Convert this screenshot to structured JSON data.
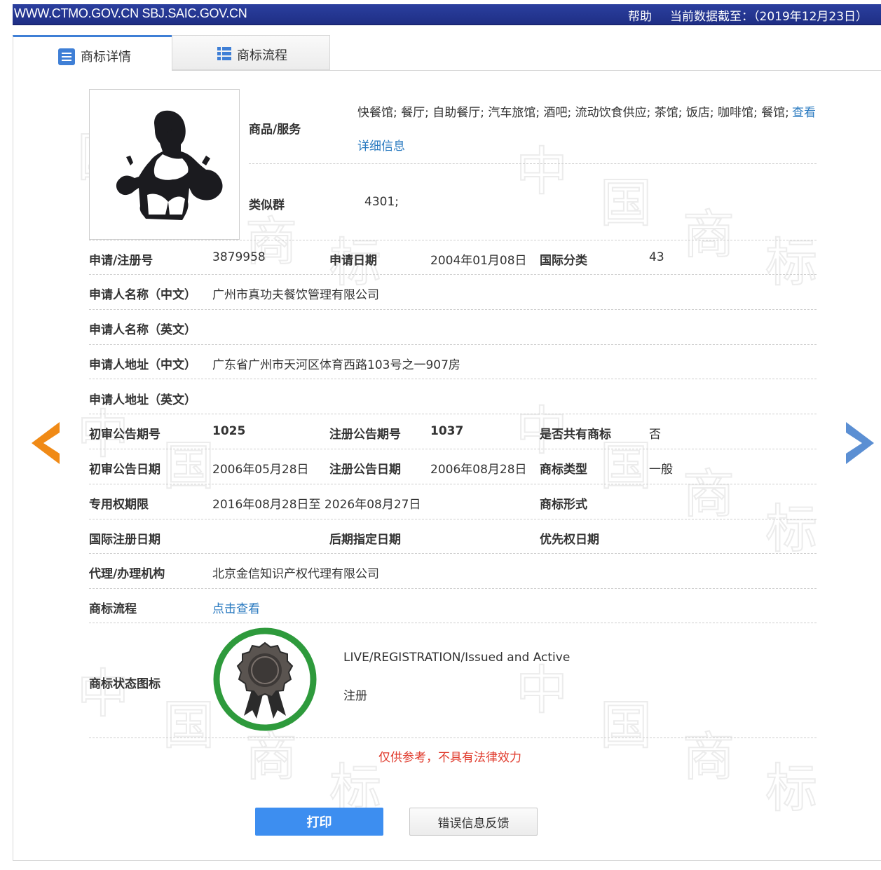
{
  "topbar": {
    "site": "WWW.CTMO.GOV.CN SBJ.SAIC.GOV.CN",
    "help": "帮助",
    "data_as_of": "当前数据截至：（2019年12月23日）"
  },
  "tabs": [
    {
      "label": "商标详情",
      "icon": "document-list-icon",
      "active": true
    },
    {
      "label": "商标流程",
      "icon": "list-grid-icon",
      "active": false
    }
  ],
  "watermark": [
    "中",
    "国",
    "商",
    "标"
  ],
  "goods": {
    "label": "商品/服务",
    "value": "快餐馆; 餐厅; 自助餐厅; 汽车旅馆; 酒吧; 流动饮食供应; 茶馆; 饭店; 咖啡馆; 餐馆;",
    "link_1": "查看",
    "link_2": "详细信息"
  },
  "similar_group": {
    "label": "类似群",
    "value": "4301;"
  },
  "fields": {
    "reg_no_label": "申请/注册号",
    "reg_no": "3879958",
    "app_date_label": "申请日期",
    "app_date": "2004年01月08日",
    "intl_class_label": "国际分类",
    "intl_class": "43",
    "applicant_cn_label": "申请人名称（中文）",
    "applicant_cn": "广州市真功夫餐饮管理有限公司",
    "applicant_en_label": "申请人名称（英文）",
    "applicant_en": "",
    "address_cn_label": "申请人地址（中文）",
    "address_cn": "广东省广州市天河区体育西路103号之一907房",
    "address_en_label": "申请人地址（英文）",
    "address_en": "",
    "prelim_issue_label": "初审公告期号",
    "prelim_issue": "1025",
    "reg_issue_label": "注册公告期号",
    "reg_issue": "1037",
    "shared_label": "是否共有商标",
    "shared": "否",
    "prelim_date_label": "初审公告日期",
    "prelim_date": "2006年05月28日",
    "reg_date_label": "注册公告日期",
    "reg_date": "2006年08月28日",
    "tm_type_label": "商标类型",
    "tm_type": "一般",
    "term_label": "专用权期限",
    "term": "2016年08月28日至 2026年08月27日",
    "tm_form_label": "商标形式",
    "tm_form": "",
    "intl_reg_date_label": "国际注册日期",
    "intl_reg_date": "",
    "later_date_label": "后期指定日期",
    "later_date": "",
    "priority_date_label": "优先权日期",
    "priority_date": "",
    "agent_label": "代理/办理机构",
    "agent": "北京金信知识产权代理有限公司",
    "flow_label": "商标流程",
    "flow_link": "点击查看"
  },
  "status": {
    "label": "商标状态图标",
    "icon": "registered-badge-icon",
    "text_en": "LIVE/REGISTRATION/Issued and Active",
    "text_cn": "注册"
  },
  "disclaimer": "仅供参考，不具有法律效力",
  "buttons": {
    "print": "打印",
    "feedback": "错误信息反馈"
  },
  "colors": {
    "accent": "#3d8ef0",
    "link": "#2a7ac0",
    "warning": "#e03b2d",
    "badge_green": "#2e9a3c",
    "prev_arrow": "#f08a16",
    "next_arrow": "#5b8fd3"
  }
}
